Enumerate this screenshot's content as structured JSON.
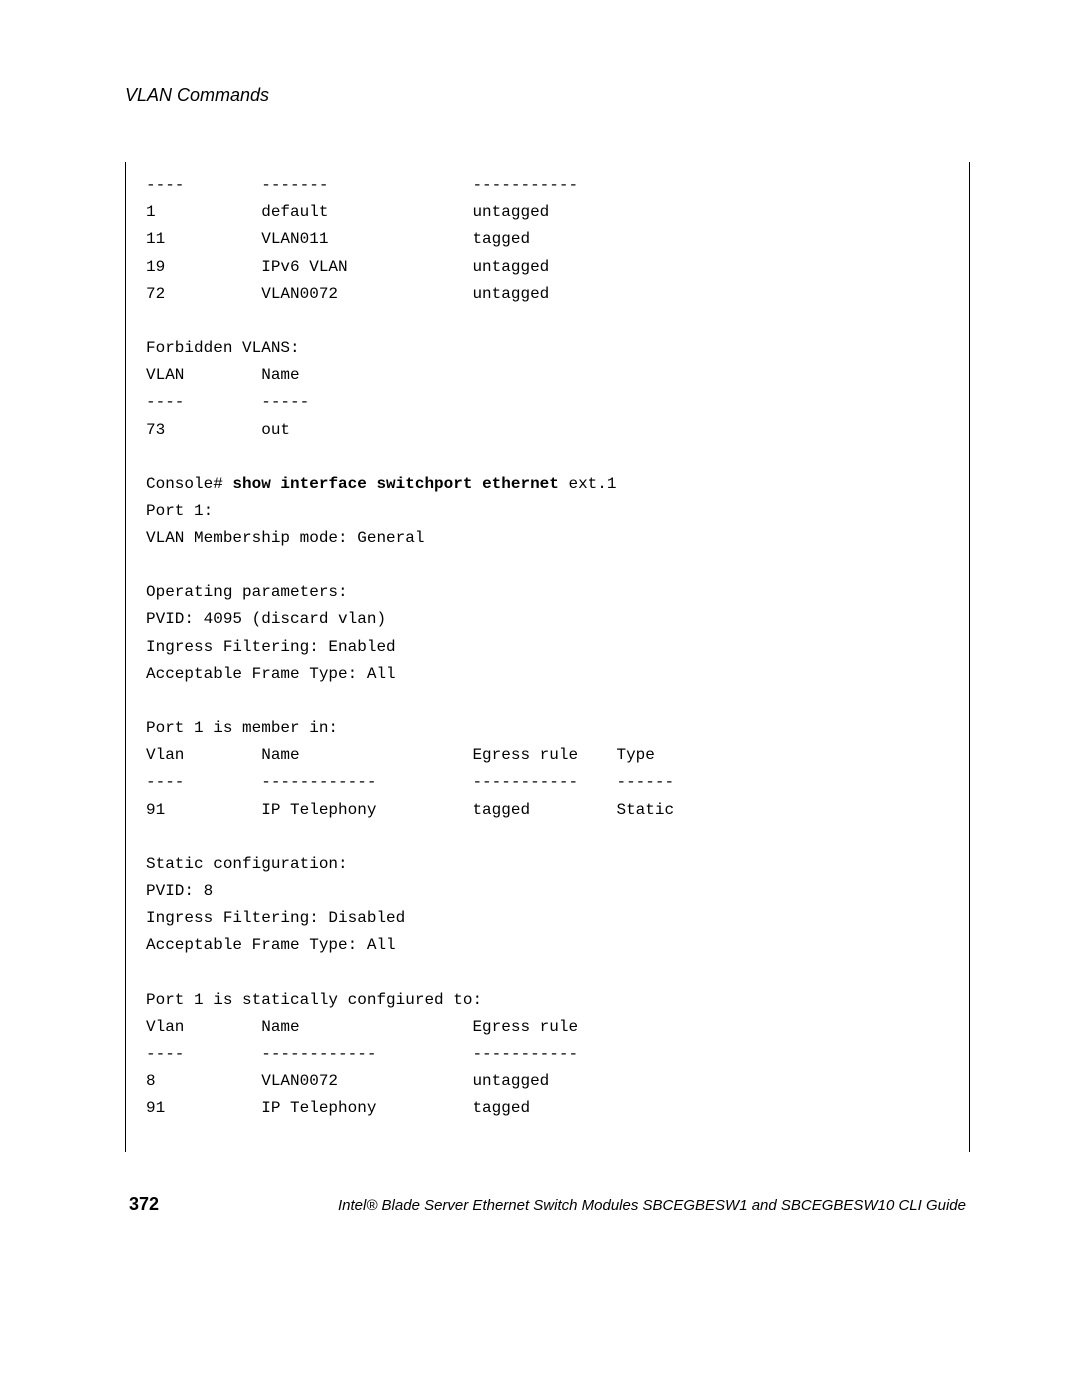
{
  "section_title": "VLAN Commands",
  "lines": [
    "----        -------               -----------",
    "1           default               untagged",
    "11          VLAN011               tagged",
    "19          IPv6 VLAN             untagged",
    "72          VLAN0072              untagged",
    "",
    "Forbidden VLANS:",
    "VLAN        Name",
    "----        -----",
    "73          out",
    ""
  ],
  "console_line": {
    "prefix": "Console# ",
    "cmd": "show interface switchport ethernet",
    "suffix": " ext.1"
  },
  "lines2": [
    "Port 1:",
    "VLAN Membership mode: General",
    "",
    "Operating parameters:",
    "PVID: 4095 (discard vlan)",
    "Ingress Filtering: Enabled",
    "Acceptable Frame Type: All",
    "",
    "Port 1 is member in:",
    "Vlan        Name                  Egress rule    Type",
    "----        ------------          -----------    ------",
    "91          IP Telephony          tagged         Static",
    "",
    "Static configuration:",
    "PVID: 8",
    "Ingress Filtering: Disabled",
    "Acceptable Frame Type: All",
    "",
    "Port 1 is statically confgiured to:",
    "Vlan        Name                  Egress rule",
    "----        ------------          -----------",
    "8           VLAN0072              untagged",
    "91          IP Telephony          tagged"
  ],
  "footer": {
    "page_num": "372",
    "text": "Intel® Blade Server Ethernet Switch Modules SBCEGBESW1 and SBCEGBESW10 CLI Guide"
  }
}
